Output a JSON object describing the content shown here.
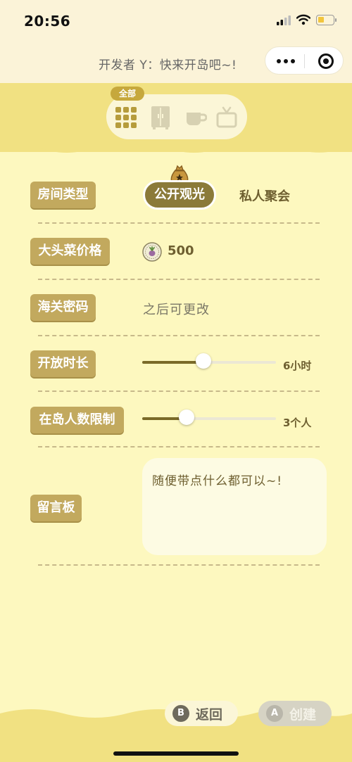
{
  "status_bar": {
    "time": "20:56"
  },
  "nav": {
    "title": "开发者 Y：快来开岛吧~!"
  },
  "categories": {
    "active_label": "全部",
    "items": [
      "grid-icon",
      "wardrobe-icon",
      "cup-icon",
      "tv-icon"
    ]
  },
  "form": {
    "room_type": {
      "label": "房间类型",
      "options": [
        "公开观光",
        "私人聚会"
      ],
      "selected": "公开观光"
    },
    "turnip_price": {
      "label": "大头菜价格",
      "value": "500"
    },
    "customs_password": {
      "label": "海关密码",
      "value": "之后可更改"
    },
    "open_duration": {
      "label": "开放时长",
      "value": "6小时",
      "level": 0.46
    },
    "island_limit": {
      "label": "在岛人数限制",
      "value": "3个人",
      "level": 0.33
    },
    "message_board": {
      "label": "留言板",
      "value": "随便带点什么都可以~!"
    }
  },
  "actions": {
    "back": {
      "key": "B",
      "label": "返回"
    },
    "create": {
      "key": "A",
      "label": "创建"
    }
  },
  "colors": {
    "background": "#fdf8bf",
    "label_bg": "#c2a95e",
    "accent": "#8b7a39",
    "band": "#f1e182"
  }
}
